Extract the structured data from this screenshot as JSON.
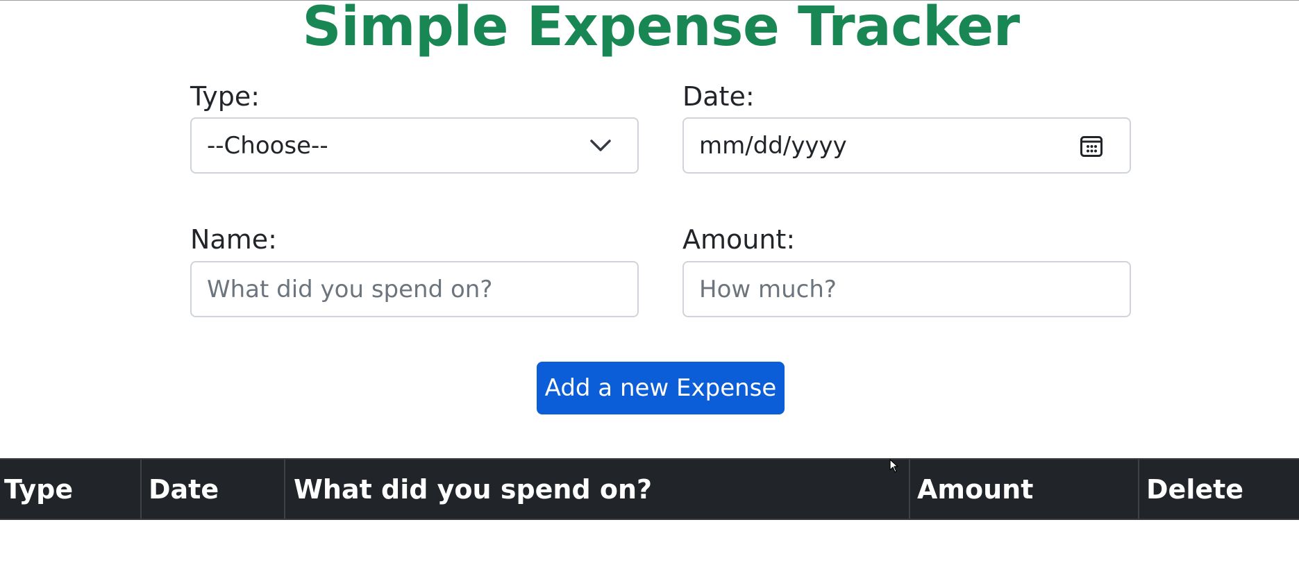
{
  "app": {
    "title": "Simple Expense Tracker",
    "accent_color": "#198754",
    "button_color": "#0b5ed7"
  },
  "form": {
    "type": {
      "label": "Type:",
      "selected": "--Choose--",
      "icon": "chevron-down-icon"
    },
    "date": {
      "label": "Date:",
      "placeholder": "mm/dd/yyyy",
      "icon": "calendar-icon"
    },
    "name": {
      "label": "Name:",
      "placeholder": "What did you spend on?",
      "value": ""
    },
    "amount": {
      "label": "Amount:",
      "placeholder": "How much?",
      "value": ""
    },
    "submit_label": "Add a new Expense"
  },
  "table": {
    "headers": [
      "Type",
      "Date",
      "What did you spend on?",
      "Amount",
      "Delete"
    ],
    "rows": []
  }
}
